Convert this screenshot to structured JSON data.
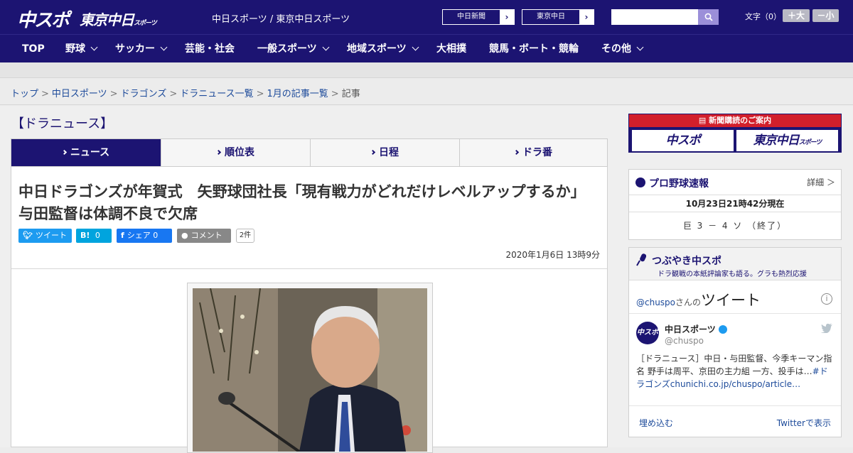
{
  "header": {
    "logo_main": "中スポ",
    "logo_tokyo": "東京中日",
    "logo_tokyo_small": "スポーツ",
    "site_name": "中日スポーツ / 東京中日スポーツ",
    "ext_links": [
      "中日新聞",
      "東京中日"
    ],
    "search": {
      "placeholder": ""
    },
    "font_size_label": "文字（0）",
    "font_plus": "＋大",
    "font_minus": "－小"
  },
  "nav": {
    "items": [
      {
        "label": "TOP",
        "dropdown": false
      },
      {
        "label": "野球",
        "dropdown": true
      },
      {
        "label": "サッカー",
        "dropdown": true
      },
      {
        "label": "芸能・社会",
        "dropdown": false
      },
      {
        "label": "一般スポーツ",
        "dropdown": true
      },
      {
        "label": "地域スポーツ",
        "dropdown": true
      },
      {
        "label": "大相撲",
        "dropdown": false
      },
      {
        "label": "競馬・ボート・競輪",
        "dropdown": false
      },
      {
        "label": "その他",
        "dropdown": true
      }
    ]
  },
  "breadcrumb": {
    "links": [
      "トップ",
      "中日スポーツ",
      "ドラゴンズ",
      "ドラニュース一覧",
      "1月の記事一覧"
    ],
    "current": "記事"
  },
  "section": {
    "title": "【ドラニュース】"
  },
  "tabs": [
    {
      "label": "ニュース",
      "active": true
    },
    {
      "label": "順位表",
      "active": false
    },
    {
      "label": "日程",
      "active": false
    },
    {
      "label": "ドラ番",
      "active": false
    }
  ],
  "article": {
    "headline": "中日ドラゴンズが年賀式　矢野球団社長「現有戦力がどれだけレベルアップするか」　与田監督は体調不良で欠席",
    "share": {
      "tweet": "ツイート",
      "hatena_icon": "B!",
      "hatena_count": "0",
      "facebook": "シェア",
      "facebook_count": "0",
      "comment": "コメント",
      "comment_count": "2件"
    },
    "date": "2020年1月6日 13時9分"
  },
  "sidebar": {
    "subscribe": {
      "title": "新聞購読のご案内",
      "logo_left": "中スポ",
      "logo_right": "東京中日",
      "logo_right_small": "スポーツ"
    },
    "baseball": {
      "title": "プロ野球速報",
      "detail": "詳細 ＞",
      "time": "10月23日21時42分現在",
      "score": "巨 3 － 4 ソ （終了）"
    },
    "twitter": {
      "title": "つぶやき中スポ",
      "subtitle": "ドラ観戦の本紙評論家も語る。グラも熱烈応援",
      "account_prefix": "@chuspo",
      "account_suffix": "さんの",
      "tweet_word": "ツイート",
      "name": "中日スポーツ",
      "handle": "@chuspo",
      "avatar_text": "中スポ",
      "text": "［ドラニュース］中日・与田監督、今季キーマン指名 野手は周平、京田の主力組 一方、投手は…",
      "text_link": "#ドラゴンズchunichi.co.jp/chuspo/article…",
      "embed": "埋め込む",
      "view_on": "Twitterで表示"
    }
  },
  "colors": {
    "brand_navy": "#1c1472",
    "subscribe_red": "#d21f2b",
    "twitter_blue": "#1d9bf0",
    "facebook_blue": "#1877f2",
    "hatena_blue": "#00a4de",
    "comment_gray": "#888888",
    "link_blue": "#1c4a9a"
  }
}
